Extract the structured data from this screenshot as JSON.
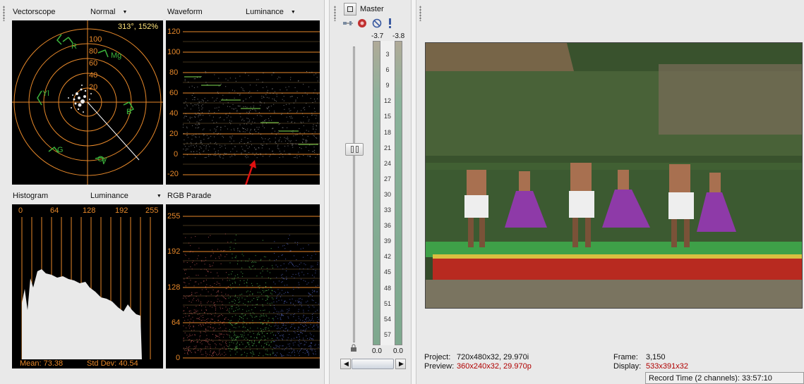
{
  "vectorscope": {
    "title": "Vectorscope",
    "mode": "Normal",
    "readout": "313°, 152%",
    "ring_labels": [
      "100",
      "80",
      "60",
      "40",
      "20"
    ],
    "targets": [
      "R",
      "Mg",
      "B",
      "Cy",
      "G",
      "Yl"
    ]
  },
  "waveform": {
    "title": "Waveform",
    "mode": "Luminance",
    "axis": [
      "120",
      "100",
      "80",
      "60",
      "40",
      "20",
      "0",
      "-20"
    ]
  },
  "histogram": {
    "title": "Histogram",
    "mode": "Luminance",
    "axis": [
      "0",
      "64",
      "128",
      "192",
      "255"
    ],
    "mean": "Mean: 73.38",
    "stddev": "Std Dev: 40.54"
  },
  "parade": {
    "title": "RGB Parade",
    "axis": [
      "255",
      "192",
      "128",
      "64",
      "0"
    ]
  },
  "mixer": {
    "title": "Master",
    "peak_left": "-3.7",
    "peak_right": "-3.8",
    "scale": [
      "3",
      "6",
      "9",
      "12",
      "15",
      "18",
      "21",
      "24",
      "27",
      "30",
      "33",
      "36",
      "39",
      "42",
      "45",
      "48",
      "51",
      "54",
      "57"
    ],
    "bottom_left": "0.0",
    "bottom_right": "0.0"
  },
  "preview": {
    "project_label": "Project:",
    "project_value": "720x480x32, 29.970i",
    "preview_label": "Preview:",
    "preview_value": "360x240x32, 29.970p",
    "frame_label": "Frame:",
    "frame_value": "3,150",
    "display_label": "Display:",
    "display_value": "533x391x32"
  },
  "status": {
    "record_time": "Record Time (2 channels): 33:57:10"
  },
  "colors": {
    "scope_bg": "#000000",
    "graticule": "#e8892a",
    "target_green": "#3cb43c",
    "readout": "#ffe47a"
  }
}
